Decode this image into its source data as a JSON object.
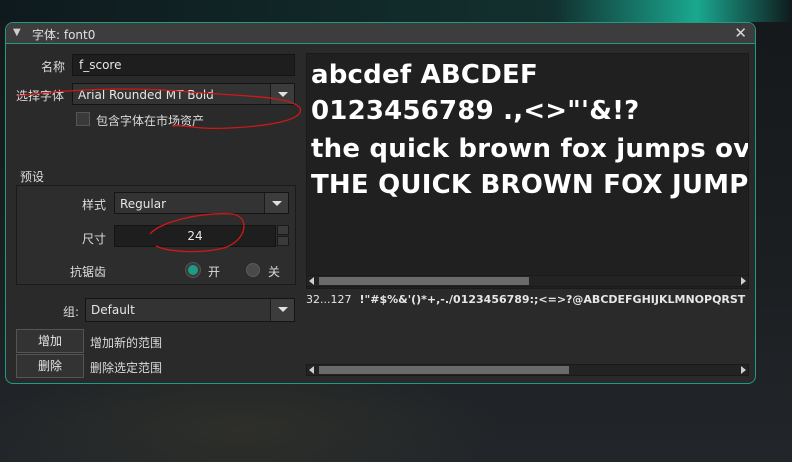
{
  "window": {
    "title": "字体: font0"
  },
  "form": {
    "name_label": "名称",
    "name_value": "f_score",
    "select_font_label": "选择字体",
    "font_value": "Arial Rounded MT Bold",
    "include_label": "包含字体在市场资产"
  },
  "preset": {
    "section_label": "预设",
    "style_label": "样式",
    "style_value": "Regular",
    "size_label": "尺寸",
    "size_value": "24",
    "aa_label": "抗锯齿",
    "aa_on": "开",
    "aa_off": "关"
  },
  "group": {
    "label": "组:",
    "value": "Default"
  },
  "buttons": {
    "add": "增加",
    "add_desc": "增加新的范围",
    "delete": "删除",
    "delete_desc": "删除选定范围"
  },
  "preview": {
    "lines": [
      "abcdef  ABCDEF",
      "0123456789 .,<>\"'&!?",
      "the quick brown fox jumps over",
      "THE QUICK BROWN FOX JUMPS"
    ]
  },
  "range": {
    "label": "32...127",
    "chars": "!\"#$%&'()*+,-./0123456789:;<=>?@ABCDEFGHIJKLMNOPQRST"
  },
  "colors": {
    "accent": "#1f9a84",
    "annotation": "#d01818"
  }
}
